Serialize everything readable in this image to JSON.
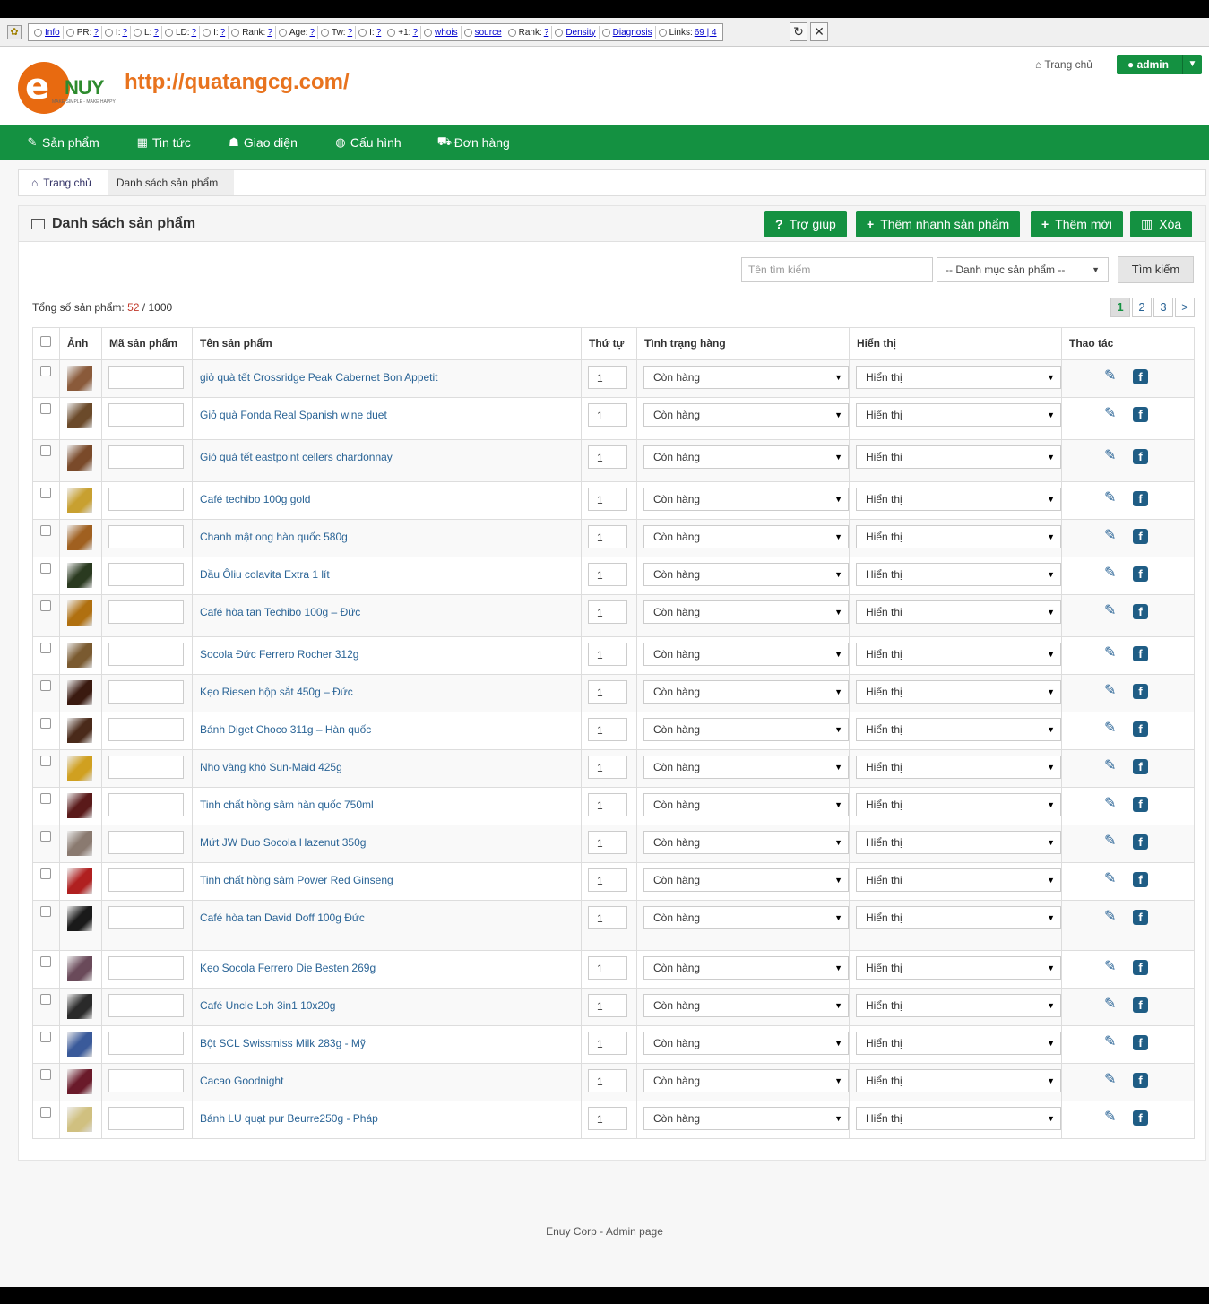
{
  "seo_bar": {
    "items": [
      {
        "label": "Info",
        "value": "",
        "icon": "info-icon"
      },
      {
        "label": "PR:",
        "value": "?",
        "icon": "google-icon"
      },
      {
        "label": "I:",
        "value": "?",
        "icon": "google-icon"
      },
      {
        "label": "L:",
        "value": "?",
        "icon": "circle-icon"
      },
      {
        "label": "LD:",
        "value": "?",
        "icon": "circle-icon"
      },
      {
        "label": "I:",
        "value": "?",
        "icon": "bing-icon"
      },
      {
        "label": "Rank:",
        "value": "?",
        "icon": "alexa-icon"
      },
      {
        "label": "Age:",
        "value": "?",
        "icon": "archive-icon"
      },
      {
        "label": "Tw:",
        "value": "?",
        "icon": "twitter-icon"
      },
      {
        "label": "I:",
        "value": "?",
        "icon": "facebook-icon"
      },
      {
        "label": "+1:",
        "value": "?",
        "icon": "gplus-icon"
      },
      {
        "label": "whois",
        "value": "",
        "icon": "whois-icon"
      },
      {
        "label": "source",
        "value": "",
        "icon": "chrome-icon"
      },
      {
        "label": "Rank:",
        "value": "?",
        "icon": "circle-icon"
      },
      {
        "label": "Density",
        "value": "",
        "icon": "bars-icon"
      },
      {
        "label": "Diagnosis",
        "value": "",
        "icon": "chart-icon"
      },
      {
        "label": "Links:",
        "value": "69 | 4",
        "icon": "gear-icon"
      }
    ]
  },
  "header": {
    "logo_text": "NUY",
    "logo_tagline": "MAKE SIMPLE - MAKE HAPPY",
    "site_url": "http://quatangcg.com/",
    "home_label": "Trang chủ",
    "user_label": "admin"
  },
  "nav": [
    {
      "label": "Sản phẩm",
      "icon": "tags-icon"
    },
    {
      "label": "Tin tức",
      "icon": "grid-icon"
    },
    {
      "label": "Giao diện",
      "icon": "user-icon"
    },
    {
      "label": "Cấu hình",
      "icon": "globe-icon"
    },
    {
      "label": "Đơn hàng",
      "icon": "cart-icon"
    }
  ],
  "breadcrumb": {
    "home": "Trang chủ",
    "current": "Danh sách sản phẩm"
  },
  "panel": {
    "title": "Danh sách sản phẩm",
    "buttons": {
      "help": "Trợ giúp",
      "quick_add": "Thêm nhanh sản phẩm",
      "add": "Thêm mới",
      "delete": "Xóa"
    }
  },
  "search": {
    "placeholder": "Tên tìm kiếm",
    "category": "-- Danh mục sản phẩm --",
    "button": "Tìm kiếm"
  },
  "summary": {
    "label": "Tổng số sản phẩm:",
    "count": "52",
    "separator": "/",
    "max": "1000"
  },
  "pagination": [
    "1",
    "2",
    "3",
    ">"
  ],
  "table": {
    "columns": [
      "Ảnh",
      "Mã sản phẩm",
      "Tên sản phẩm",
      "Thứ tự",
      "Tình trạng hàng",
      "Hiển thị",
      "Thao tác"
    ],
    "rows": [
      {
        "name": "giỏ quà tết Crossridge Peak Cabernet Bon Appetit",
        "order": "1",
        "status": "Còn hàng",
        "display": "Hiển thị",
        "thumb_color": "#8a5a3a"
      },
      {
        "name": "Giỏ quà Fonda Real Spanish wine duet",
        "order": "1",
        "status": "Còn hàng",
        "display": "Hiển thị",
        "thumb_color": "#6b4a2a"
      },
      {
        "name": "Giỏ quà tết eastpoint cellers chardonnay",
        "order": "1",
        "status": "Còn hàng",
        "display": "Hiển thị",
        "thumb_color": "#7a4a2a"
      },
      {
        "name": "Café techibo 100g gold",
        "order": "1",
        "status": "Còn hàng",
        "display": "Hiển thị",
        "thumb_color": "#c8a030"
      },
      {
        "name": "Chanh mật ong hàn quốc 580g",
        "order": "1",
        "status": "Còn hàng",
        "display": "Hiển thị",
        "thumb_color": "#a06020"
      },
      {
        "name": "Dầu Ôliu colavita Extra 1 lít",
        "order": "1",
        "status": "Còn hàng",
        "display": "Hiển thị",
        "thumb_color": "#2a3a20"
      },
      {
        "name": "Café hòa tan Techibo 100g – Đức",
        "order": "1",
        "status": "Còn hàng",
        "display": "Hiển thị",
        "thumb_color": "#b07010"
      },
      {
        "name": "Socola Đức Ferrero Rocher 312g",
        "order": "1",
        "status": "Còn hàng",
        "display": "Hiển thị",
        "thumb_color": "#7a5a30"
      },
      {
        "name": "Kẹo Riesen hộp sắt 450g – Đức",
        "order": "1",
        "status": "Còn hàng",
        "display": "Hiển thị",
        "thumb_color": "#3a1a10"
      },
      {
        "name": "Bánh Diget Choco 311g – Hàn quốc",
        "order": "1",
        "status": "Còn hàng",
        "display": "Hiển thị",
        "thumb_color": "#4a2a1a"
      },
      {
        "name": "Nho vàng khô Sun-Maid 425g",
        "order": "1",
        "status": "Còn hàng",
        "display": "Hiển thị",
        "thumb_color": "#d0a020"
      },
      {
        "name": "Tinh chất hồng sâm hàn quốc 750ml",
        "order": "1",
        "status": "Còn hàng",
        "display": "Hiển thị",
        "thumb_color": "#5a1a1a"
      },
      {
        "name": "Mứt JW Duo Socola Hazenut 350g",
        "order": "1",
        "status": "Còn hàng",
        "display": "Hiển thị",
        "thumb_color": "#8a7a70"
      },
      {
        "name": "Tinh chất hồng sâm Power Red Ginseng",
        "order": "1",
        "status": "Còn hàng",
        "display": "Hiển thị",
        "thumb_color": "#b02020"
      },
      {
        "name": "Café hòa tan David Doff 100g Đức",
        "order": "1",
        "status": "Còn hàng",
        "display": "Hiển thị",
        "thumb_color": "#1a1a1a"
      },
      {
        "name": "Kẹo Socola Ferrero Die Besten 269g",
        "order": "1",
        "status": "Còn hàng",
        "display": "Hiển thị",
        "thumb_color": "#6a4a5a"
      },
      {
        "name": "Café Uncle Loh 3in1 10x20g",
        "order": "1",
        "status": "Còn hàng",
        "display": "Hiển thị",
        "thumb_color": "#2a2a2a"
      },
      {
        "name": "Bột SCL Swissmiss Milk 283g - Mỹ",
        "order": "1",
        "status": "Còn hàng",
        "display": "Hiển thị",
        "thumb_color": "#3a5a9a"
      },
      {
        "name": "Cacao Goodnight",
        "order": "1",
        "status": "Còn hàng",
        "display": "Hiển thị",
        "thumb_color": "#6a1a2a"
      },
      {
        "name": "Bánh LU quạt pur Beurre250g - Pháp",
        "order": "1",
        "status": "Còn hàng",
        "display": "Hiển thị",
        "thumb_color": "#d0c080"
      }
    ]
  },
  "footer": "Enuy Corp - Admin page",
  "colors": {
    "brand_green": "#149141",
    "link_blue": "#2a6496",
    "logo_orange": "#e86a10",
    "url_orange": "#e8731e"
  }
}
